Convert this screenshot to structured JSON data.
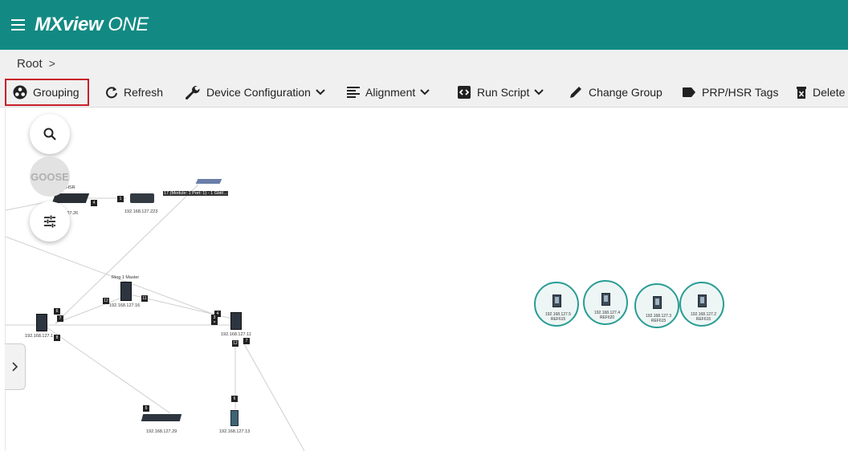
{
  "app": {
    "logo_bold": "MXview",
    "logo_suffix": "ONE"
  },
  "breadcrumb": {
    "root": "Root",
    "separator": ">"
  },
  "toolbar": {
    "grouping": "Grouping",
    "refresh": "Refresh",
    "device_configuration": "Device Configuration",
    "alignment": "Alignment",
    "run_script": "Run Script",
    "change_group": "Change Group",
    "prp_hsr_tags": "PRP/HSR Tags",
    "delete": "Delete"
  },
  "fabs": {
    "goose": "GOOSE"
  },
  "topology": {
    "devices": [
      {
        "ip": "192.168.127.26",
        "name": "HSR"
      },
      {
        "ip": "192.168.127.223"
      },
      {
        "ip": "",
        "name": "17 (Module: 1 Port: 1) - 1 Gbit/..."
      },
      {
        "ip": "192.168.127.16",
        "name": "Ring 1 Master"
      },
      {
        "ip": "192.168.127.11"
      },
      {
        "ip": "192.168.127.1"
      },
      {
        "ip": "192.168.127.29"
      },
      {
        "ip": "192.168.127.13"
      }
    ],
    "ports": [
      "4",
      "1",
      "12",
      "11",
      "6",
      "7",
      "4",
      "6",
      "3",
      "12",
      "7",
      "8",
      "5",
      "6"
    ],
    "groups": [
      {
        "ip": "192.168.127.5",
        "model": "REF615"
      },
      {
        "ip": "192.168.127.4",
        "model": "REF620"
      },
      {
        "ip": "192.168.127.3",
        "model": "REF615"
      },
      {
        "ip": "192.168.127.2",
        "model": "REF615"
      }
    ]
  },
  "colors": {
    "header": "#128a83",
    "active_border": "#c8202a",
    "group_ring": "#2a9d94"
  }
}
